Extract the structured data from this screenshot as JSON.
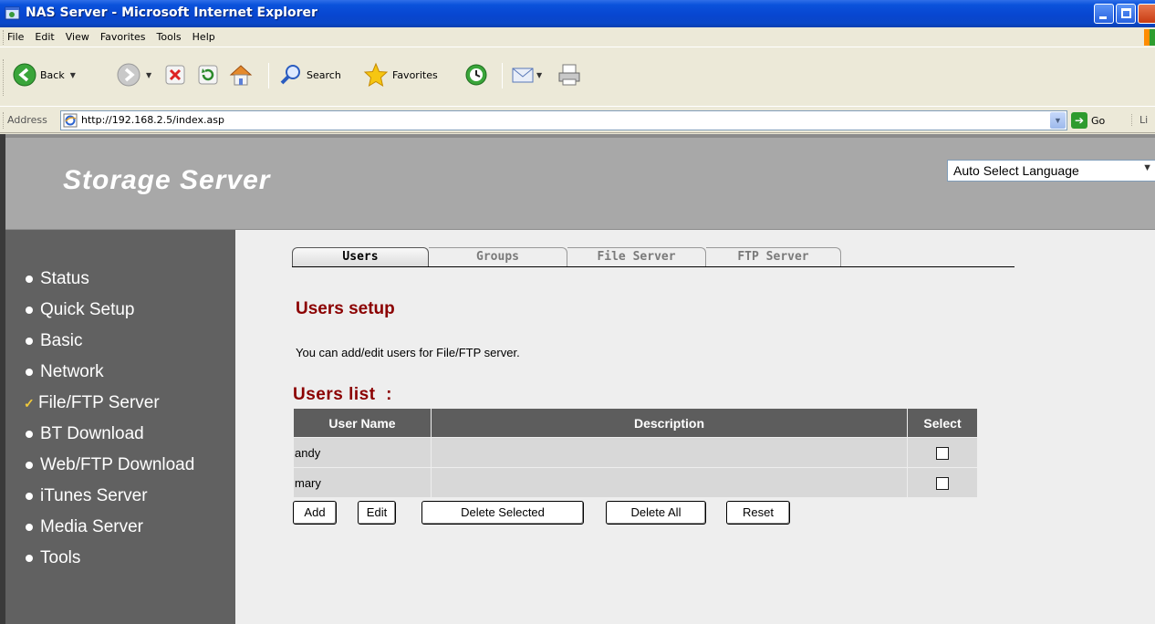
{
  "window": {
    "title": "NAS Server - Microsoft Internet Explorer"
  },
  "menu": [
    "File",
    "Edit",
    "View",
    "Favorites",
    "Tools",
    "Help"
  ],
  "toolbar": {
    "back_label": "Back",
    "search_label": "Search",
    "favorites_label": "Favorites"
  },
  "address": {
    "label": "Address",
    "url": "http://192.168.2.5/index.asp",
    "go_label": "Go",
    "links_label": "Li"
  },
  "header": {
    "brand": "Storage Server",
    "language_selected": "Auto Select Language"
  },
  "sidebar": {
    "items": [
      {
        "label": "Status",
        "active": false
      },
      {
        "label": "Quick Setup",
        "active": false
      },
      {
        "label": "Basic",
        "active": false
      },
      {
        "label": "Network",
        "active": false
      },
      {
        "label": "File/FTP Server",
        "active": true
      },
      {
        "label": "BT Download",
        "active": false
      },
      {
        "label": "Web/FTP Download",
        "active": false
      },
      {
        "label": "iTunes Server",
        "active": false
      },
      {
        "label": "Media Server",
        "active": false
      },
      {
        "label": "Tools",
        "active": false
      }
    ]
  },
  "tabs": [
    {
      "label": "Users",
      "active": true
    },
    {
      "label": "Groups",
      "active": false
    },
    {
      "label": "File Server",
      "active": false
    },
    {
      "label": "FTP Server",
      "active": false
    }
  ],
  "main": {
    "heading": "Users setup",
    "description": "You can add/edit users for File/FTP server.",
    "list_title": "Users list  :"
  },
  "users_table": {
    "columns": [
      "User Name",
      "Description",
      "Select"
    ],
    "rows": [
      {
        "name": "andy",
        "description": "",
        "selected": false
      },
      {
        "name": "mary",
        "description": "",
        "selected": false
      }
    ]
  },
  "buttons": {
    "add": "Add",
    "edit": "Edit",
    "delete_selected": "Delete Selected",
    "delete_all": "Delete All",
    "reset": "Reset"
  }
}
